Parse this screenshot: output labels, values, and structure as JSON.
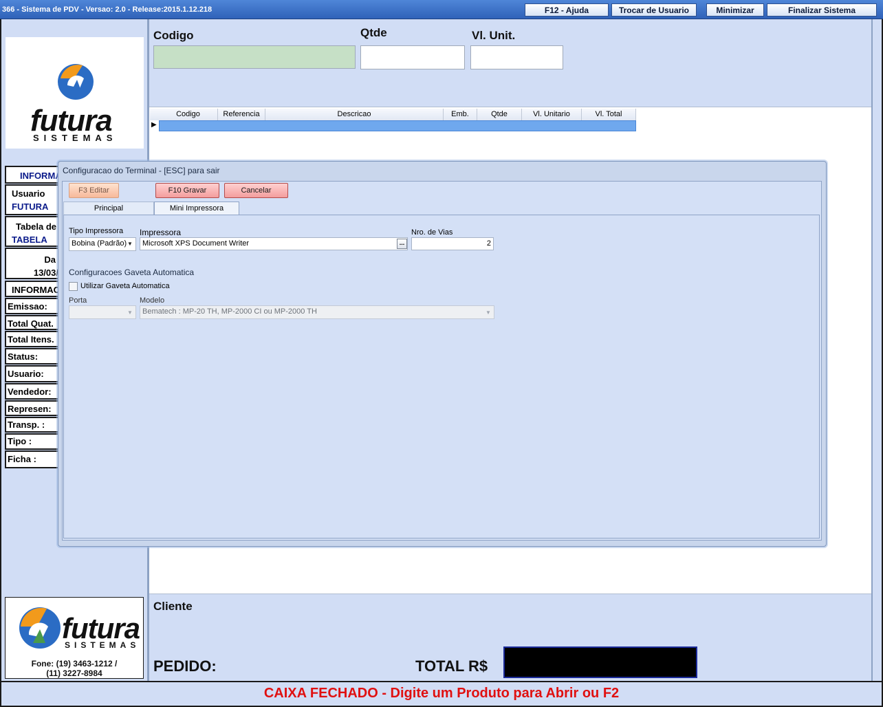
{
  "window": {
    "title": "366 - Sistema de PDV - Versao: 2.0 - Release:2015.1.12.218",
    "buttons": {
      "help": "F12 - Ajuda",
      "switch_user": "Trocar de Usuario",
      "minimize": "Minimizar",
      "exit": "Finalizar Sistema"
    }
  },
  "logo": {
    "brand": "futura",
    "tagline": "SISTEMAS"
  },
  "left_panel": {
    "info_header": "INFORMA",
    "user_label": "Usuario",
    "user_value": "FUTURA",
    "price_table_label": "Tabela de",
    "price_table_value": "TABELA",
    "date_label": "Da",
    "date_value": "13/03/",
    "info_header2": "INFORMAC",
    "fields": [
      "Emissao:",
      "Total Quat.",
      "Total Itens.",
      "Status:",
      "Usuario:",
      "Vendedor:",
      "Represen:",
      "Transp. :",
      "Tipo :",
      "Ficha :"
    ]
  },
  "footer_logo": {
    "phone_line1": "Fone: (19) 3463-1212 /",
    "phone_line2": "(11) 3227-8984"
  },
  "entry": {
    "code_label": "Codigo",
    "qty_label": "Qtde",
    "unit_price_label": "Vl. Unit.",
    "code_value": "",
    "qty_value": "",
    "unit_price_value": ""
  },
  "grid": {
    "columns": [
      "Codigo",
      "Referencia",
      "Descricao",
      "Emb.",
      "Qtde",
      "Vl. Unitario",
      "Vl. Total"
    ]
  },
  "dialog": {
    "title": "Configuracao do Terminal - [ESC] para sair",
    "buttons": {
      "edit": "F3 Editar",
      "save": "F10 Gravar",
      "cancel": "Cancelar"
    },
    "tabs": [
      "Principal",
      "Mini Impressora"
    ],
    "active_tab": "Mini Impressora",
    "printer_type_label": "Tipo Impressora",
    "printer_type_value": "Bobina (Padrão)",
    "printer_label": "Impressora",
    "printer_value": "Microsoft XPS Document Writer",
    "browse_label": "...",
    "copies_label": "Nro. de Vias",
    "copies_value": "2",
    "drawer_section": "Configuracoes Gaveta Automatica",
    "drawer_checkbox_label": "Utilizar Gaveta Automatica",
    "drawer_checked": false,
    "port_label": "Porta",
    "port_value": "",
    "model_label": "Modelo",
    "model_value": "Bematech : MP-20 TH, MP-2000 CI ou MP-2000 TH"
  },
  "bottom": {
    "client_label": "Cliente",
    "order_label": "PEDIDO:",
    "total_label": "TOTAL R$",
    "status_message": "CAIXA FECHADO - Digite um Produto para Abrir ou F2"
  },
  "colors": {
    "background": "#d1ddf5",
    "title_bar": "#3a6fc4",
    "status_text": "#e01010",
    "row_highlight": "#6fa8ee",
    "code_input": "#c6e0c6"
  }
}
